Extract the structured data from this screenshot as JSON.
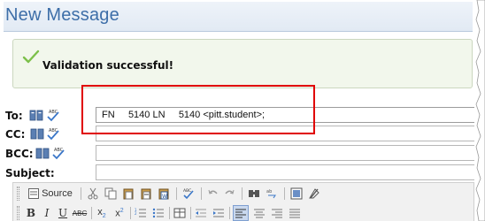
{
  "window": {
    "title": "New Message"
  },
  "banner": {
    "message": "Validation successful!",
    "icon": "checkmark-icon",
    "accent": "#7cc04a"
  },
  "fields": {
    "to": {
      "label": "To:",
      "value": "FN     5140 LN     5140 <pitt.student>;"
    },
    "cc": {
      "label": "CC:",
      "value": ""
    },
    "bcc": {
      "label": "BCC:",
      "value": ""
    },
    "subject": {
      "label": "Subject:",
      "value": ""
    }
  },
  "toolbar": {
    "source_label": "Source",
    "row1_icons": [
      "source-icon",
      "cut-icon",
      "copy-icon",
      "paste-icon",
      "paste-text-icon",
      "paste-word-icon",
      "spellcheck-icon",
      "undo-icon",
      "redo-icon",
      "find-icon",
      "replace-icon",
      "select-all-icon",
      "remove-format-icon"
    ],
    "row2_icons": [
      "bold-icon",
      "italic-icon",
      "underline-icon",
      "strike-icon",
      "subscript-icon",
      "superscript-icon",
      "numbered-list-icon",
      "bulleted-list-icon",
      "table-icon",
      "outdent-icon",
      "indent-icon",
      "align-left-icon",
      "align-center-icon",
      "align-right-icon",
      "justify-icon"
    ]
  },
  "colors": {
    "title": "#3d6ea8",
    "highlight": "#e00000"
  }
}
